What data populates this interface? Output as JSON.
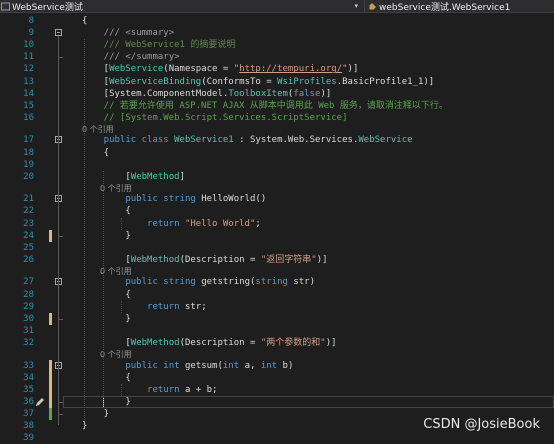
{
  "nav": {
    "project_dropdown": "WebService测试",
    "class_dropdown": "webService测试.WebService1",
    "caret": "▾"
  },
  "editor": {
    "lines": [
      {
        "num": "8",
        "segs": [
          [
            "p",
            "{"
          ]
        ]
      },
      {
        "num": "9",
        "segs": [
          [
            "g",
            "    /// "
          ],
          [
            "g",
            "<summary>"
          ]
        ]
      },
      {
        "num": "10",
        "segs": [
          [
            "d",
            "    /// WebService1 的摘要说明"
          ]
        ]
      },
      {
        "num": "11",
        "segs": [
          [
            "g",
            "    /// "
          ],
          [
            "g",
            "</summary>"
          ]
        ]
      },
      {
        "num": "12",
        "segs": [
          [
            "p",
            "    ["
          ],
          [
            "t",
            "WebService"
          ],
          [
            "p",
            "(Namespace = "
          ],
          [
            "s",
            "\""
          ],
          [
            "u",
            "http://tempuri.org/"
          ],
          [
            "s",
            "\""
          ],
          [
            "p",
            ")]"
          ]
        ]
      },
      {
        "num": "13",
        "segs": [
          [
            "p",
            "    ["
          ],
          [
            "t",
            "WebServiceBinding"
          ],
          [
            "p",
            "(ConformsTo = "
          ],
          [
            "t",
            "WsiProfiles"
          ],
          [
            "p",
            ".BasicProfile1_1)]"
          ]
        ]
      },
      {
        "num": "14",
        "segs": [
          [
            "p",
            "    [System.ComponentModel."
          ],
          [
            "t",
            "ToolboxItem"
          ],
          [
            "p",
            "("
          ],
          [
            "k",
            "false"
          ],
          [
            "p",
            ")]"
          ]
        ]
      },
      {
        "num": "15",
        "segs": [
          [
            "c",
            "    // 若要允许使用 ASP.NET AJAX 从脚本中调用此 Web 服务，请取消注释以下行。"
          ]
        ]
      },
      {
        "num": "16",
        "segs": [
          [
            "c",
            "    // [System.Web.Script.Services.ScriptService]"
          ]
        ]
      },
      {
        "num": "17",
        "segs": [
          [
            "k",
            "    public class "
          ],
          [
            "t",
            "WebService1"
          ],
          [
            "p",
            " : System.Web.Services."
          ],
          [
            "t",
            "WebService"
          ]
        ]
      },
      {
        "num": "18",
        "segs": [
          [
            "p",
            "    {"
          ]
        ]
      },
      {
        "num": "19",
        "segs": []
      },
      {
        "num": "20",
        "segs": [
          [
            "p",
            "        ["
          ],
          [
            "t",
            "WebMethod"
          ],
          [
            "p",
            "]"
          ]
        ]
      },
      {
        "num": "21",
        "segs": [
          [
            "k",
            "        public string "
          ],
          [
            "p",
            "HelloWorld()"
          ]
        ]
      },
      {
        "num": "22",
        "segs": [
          [
            "p",
            "        {"
          ]
        ]
      },
      {
        "num": "23",
        "segs": [
          [
            "k",
            "            return "
          ],
          [
            "s",
            "\"Hello World\""
          ],
          [
            "p",
            ";"
          ]
        ]
      },
      {
        "num": "24",
        "segs": [
          [
            "p",
            "        }"
          ]
        ]
      },
      {
        "num": "25",
        "segs": []
      },
      {
        "num": "26",
        "segs": [
          [
            "p",
            "        ["
          ],
          [
            "t",
            "WebMethod"
          ],
          [
            "p",
            "(Description = "
          ],
          [
            "s",
            "\"返回字符串\""
          ],
          [
            "p",
            ")]"
          ]
        ]
      },
      {
        "num": "27",
        "segs": [
          [
            "k",
            "        public string "
          ],
          [
            "p",
            "getstring("
          ],
          [
            "k",
            "string "
          ],
          [
            "p",
            "str)"
          ]
        ]
      },
      {
        "num": "28",
        "segs": [
          [
            "p",
            "        {"
          ]
        ]
      },
      {
        "num": "29",
        "segs": [
          [
            "k",
            "            return "
          ],
          [
            "p",
            "str;"
          ]
        ]
      },
      {
        "num": "30",
        "segs": [
          [
            "p",
            "        }"
          ]
        ]
      },
      {
        "num": "31",
        "segs": []
      },
      {
        "num": "32",
        "segs": [
          [
            "p",
            "        ["
          ],
          [
            "t",
            "WebMethod"
          ],
          [
            "p",
            "(Description = "
          ],
          [
            "s",
            "\"两个参数的和\""
          ],
          [
            "p",
            ")]"
          ]
        ]
      },
      {
        "num": "33",
        "segs": [
          [
            "k",
            "        public int "
          ],
          [
            "p",
            "getsum("
          ],
          [
            "k",
            "int "
          ],
          [
            "p",
            "a, "
          ],
          [
            "k",
            "int "
          ],
          [
            "p",
            "b)"
          ]
        ]
      },
      {
        "num": "34",
        "segs": [
          [
            "p",
            "        {"
          ]
        ]
      },
      {
        "num": "35",
        "segs": [
          [
            "k",
            "            return "
          ],
          [
            "p",
            "a + b;"
          ]
        ]
      },
      {
        "num": "36",
        "segs": [
          [
            "p",
            "        }"
          ]
        ]
      },
      {
        "num": "37",
        "segs": [
          [
            "p",
            "    }"
          ]
        ]
      },
      {
        "num": "38",
        "segs": [
          [
            "p",
            "}"
          ]
        ]
      },
      {
        "num": "39",
        "segs": []
      }
    ],
    "ref_label": "0 个引用",
    "ref_before": [
      "17",
      "21",
      "27",
      "33"
    ]
  },
  "watermark": "CSDN @JosieBook",
  "colors": {
    "background": "#1e1e1e",
    "line_number": "#2b91af",
    "keyword": "#569cd6",
    "type": "#4ec9b0",
    "string": "#d69d85",
    "comment": "#57a64a",
    "change_marker": "#d7ba7d"
  }
}
